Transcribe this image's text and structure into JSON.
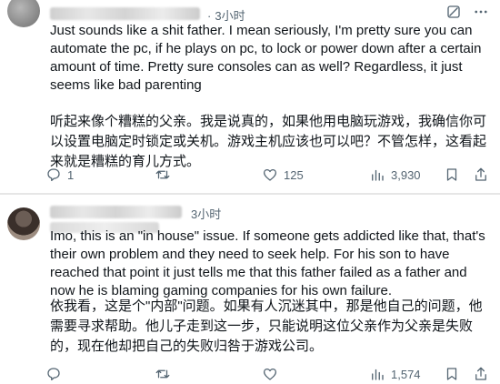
{
  "posts": [
    {
      "time": "3小时",
      "text_en": "Just sounds like a shit father. I mean seriously, I'm pretty sure you can automate the pc, if he plays on pc, to lock or power down after a certain amount of time. Pretty sure consoles can as well? Regardless, it just seems like bad parenting",
      "text_zh": "听起来像个糟糕的父亲。我是说真的，如果他用电脑玩游戏，我确信你可以设置电脑定时锁定或关机。游戏主机应该也可以吧？不管怎样，这看起来就是糟糕的育儿方式。",
      "actions": {
        "replies": "1",
        "retweets": "",
        "likes": "125",
        "views": "3,930"
      }
    },
    {
      "time": "3小时",
      "text_en": "Imo, this is an \"in house\" issue. If someone gets addicted like that, that's their own problem and they need to seek help. For his son to have reached that point it just tells me that this father failed as a father and now he is blaming gaming companies for his own failure.",
      "text_zh": "依我看，这是个\"内部\"问题。如果有人沉迷其中，那是他自己的问题，他需要寻求帮助。他儿子走到这一步，只能说明这位父亲作为父亲是失败的，现在他却把自己的失败归咎于游戏公司。",
      "actions": {
        "replies": "",
        "retweets": "",
        "likes": "",
        "views": "1,574"
      }
    }
  ],
  "icons": {
    "grok": "grok-icon",
    "more": "more-icon",
    "reply": "reply-icon",
    "retweet": "retweet-icon",
    "like": "heart-icon",
    "views": "views-icon",
    "bookmark": "bookmark-icon",
    "share": "share-icon"
  },
  "colors": {
    "text": "#0f1419",
    "muted": "#536471",
    "divider": "#e6e6e6"
  }
}
